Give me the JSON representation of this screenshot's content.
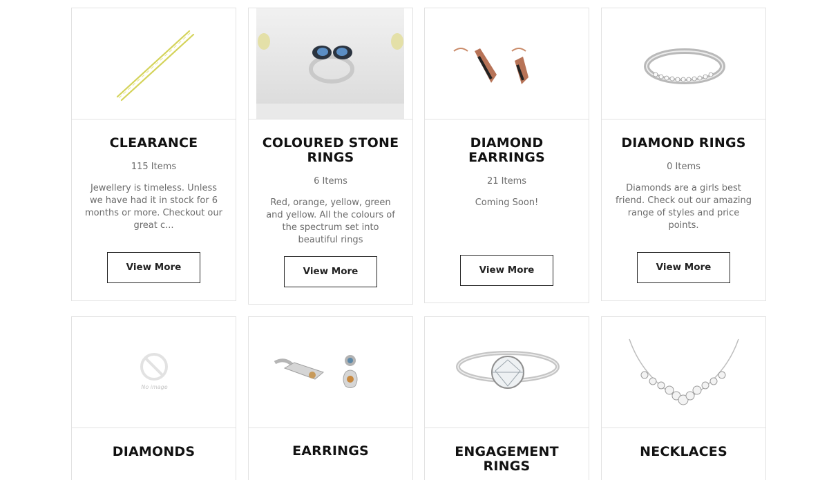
{
  "categories": [
    {
      "title": "CLEARANCE",
      "count": "115 Items",
      "description": "Jewellery is timeless.  Unless we have had it in stock for 6 months or more. Checkout our great c...",
      "button": "View More",
      "image": "gold-chain-bracelet"
    },
    {
      "title": "COLOURED STONE RINGS",
      "count": "6 Items",
      "description": "Red, orange, yellow, green and yellow.  All the colours of the spectrum set into beautiful rings",
      "button": "View More",
      "image": "blue-stone-ring"
    },
    {
      "title": "DIAMOND EARRINGS",
      "count": "21 Items",
      "description": "Coming Soon!",
      "button": "View More",
      "image": "rose-gold-earrings"
    },
    {
      "title": "DIAMOND RINGS",
      "count": "0 Items",
      "description": "Diamonds are a girls best friend.  Check out our amazing range of styles and price points.",
      "button": "View More",
      "image": "diamond-band-ring"
    },
    {
      "title": "DIAMONDS",
      "count": "",
      "description": "",
      "button": "",
      "image": "no-image-placeholder",
      "placeholder_text": "No image"
    },
    {
      "title": "EARRINGS",
      "count": "",
      "description": "",
      "button": "",
      "image": "drop-earrings"
    },
    {
      "title": "ENGAGEMENT RINGS",
      "count": "",
      "description": "",
      "button": "",
      "image": "solitaire-ring"
    },
    {
      "title": "NECKLACES",
      "count": "",
      "description": "",
      "button": "",
      "image": "diamond-necklace"
    }
  ]
}
